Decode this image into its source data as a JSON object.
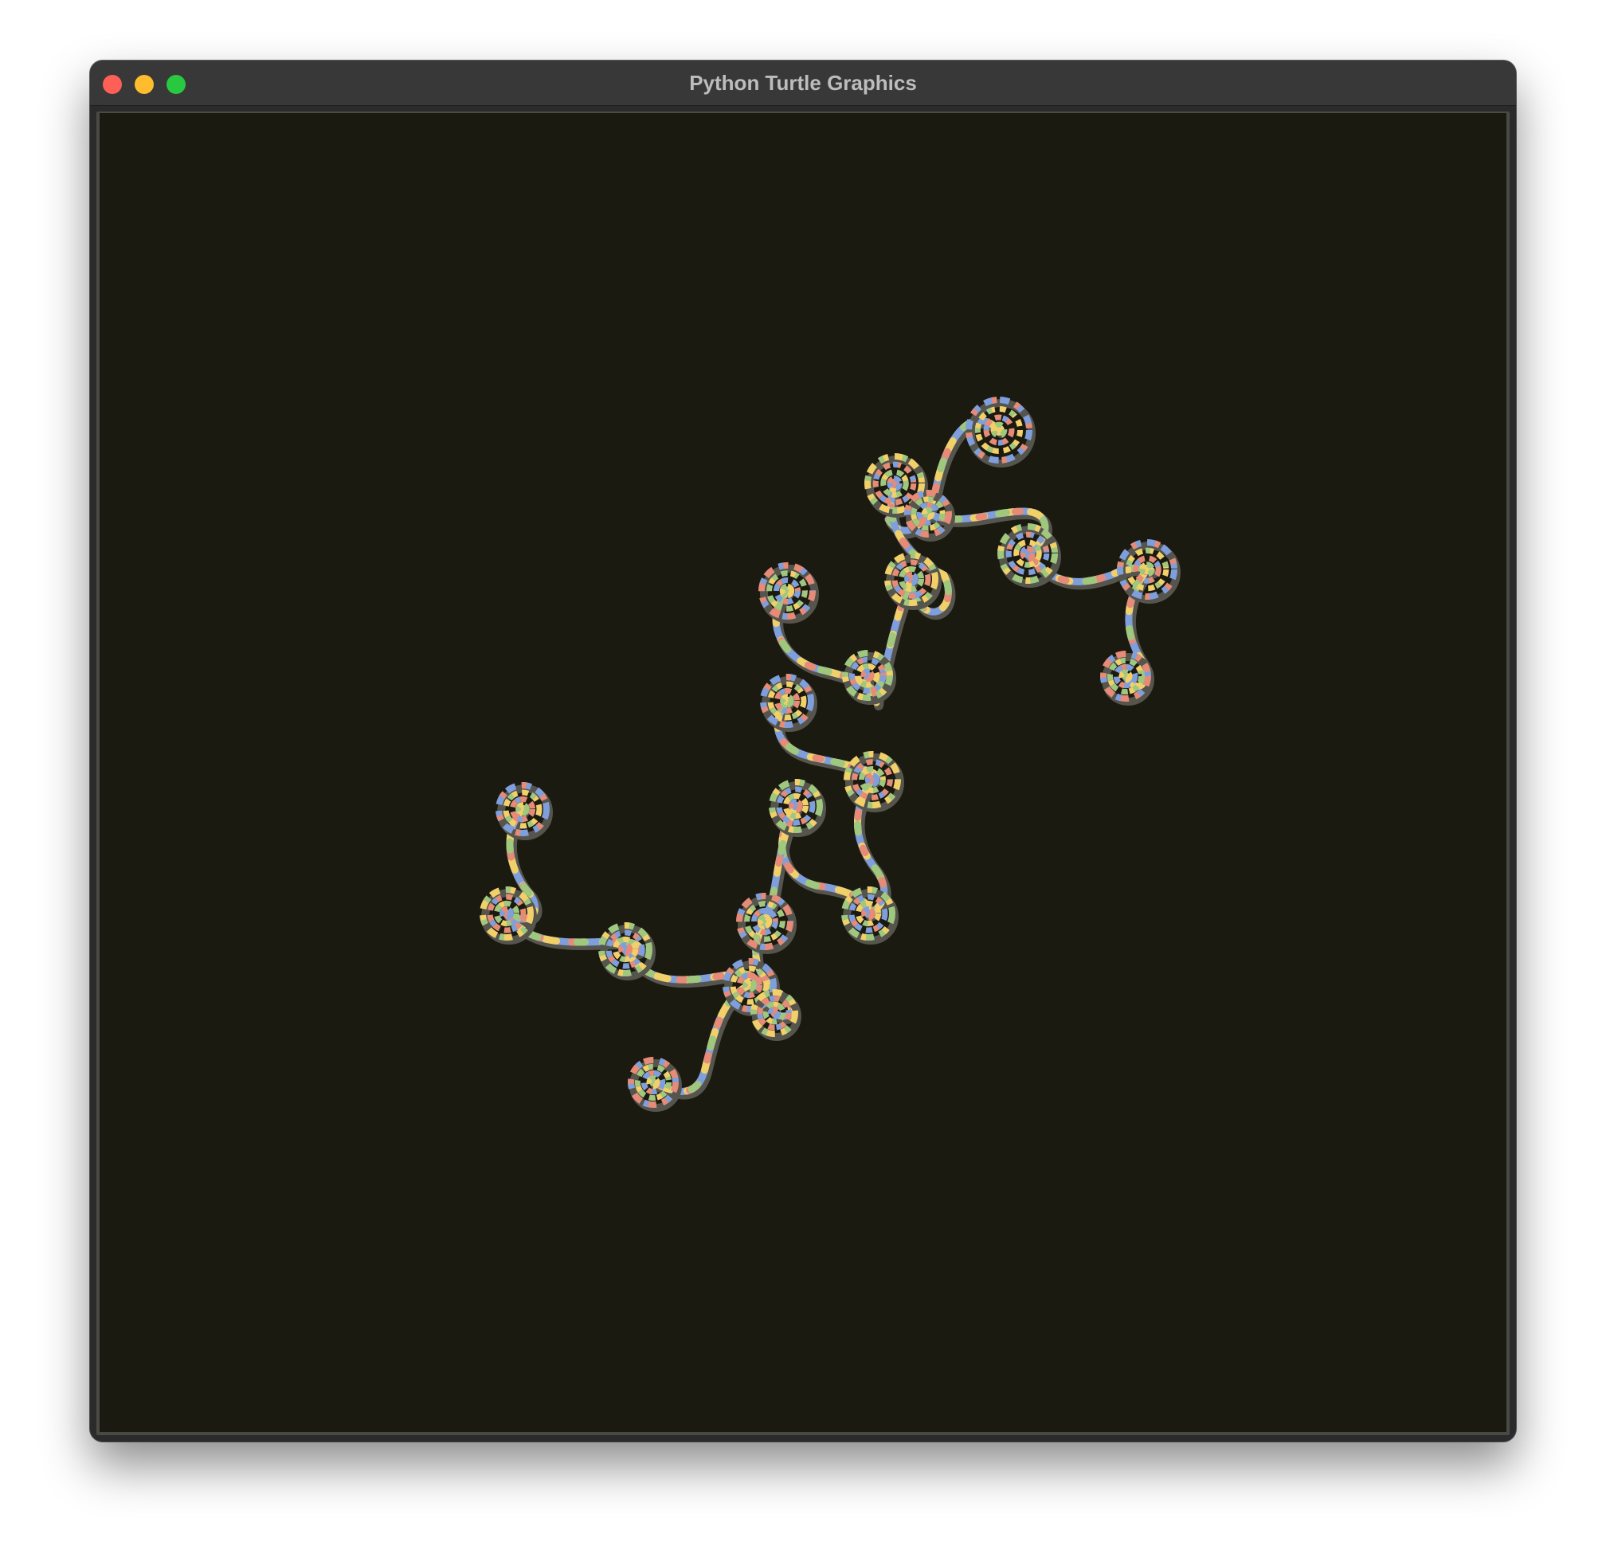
{
  "window": {
    "title": "Python Turtle Graphics"
  },
  "colors": {
    "close": "#fe5f57",
    "minimize": "#febc2e",
    "maximize": "#28c840",
    "canvas_background": "#1b1a11",
    "stroke_palette": [
      "#7f9fdc",
      "#f1d06a",
      "#e58b78",
      "#9fc77e",
      "#8a8a9a"
    ]
  },
  "drawing": {
    "description_icon": "turtle-fractal-spiral-curves"
  }
}
